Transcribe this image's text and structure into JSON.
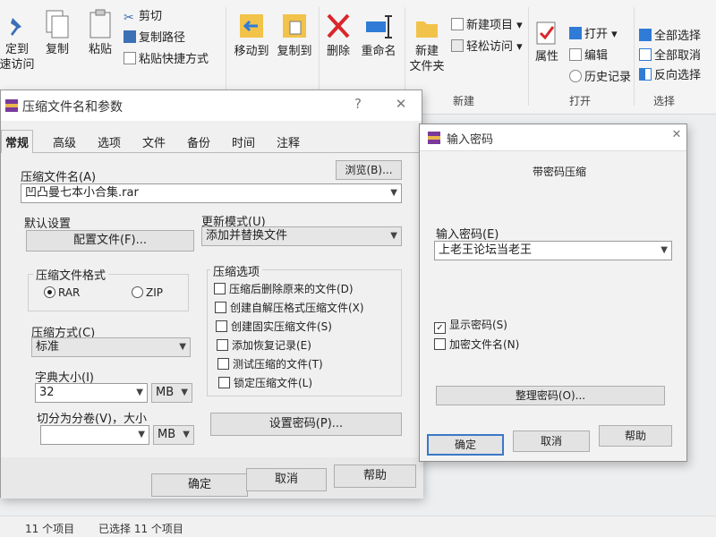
{
  "ribbon": {
    "pin_label": "定到\n速访问",
    "copy_label": "复制",
    "paste_label": "粘贴",
    "cut_label": "剪切",
    "copy_path_label": "复制路径",
    "paste_shortcut_label": "粘贴快捷方式",
    "move_to_label": "移动到",
    "copy_to_label": "复制到",
    "delete_label": "删除",
    "rename_label": "重命名",
    "new_folder_label": "新建\n文件夹",
    "new_item_label": "新建项目",
    "easy_access_label": "轻松访问",
    "new_group_label": "新建",
    "properties_label": "属性",
    "open_label": "打开",
    "edit_label": "编辑",
    "history_label": "历史记录",
    "open_group_label": "打开",
    "select_all_label": "全部选择",
    "select_none_label": "全部取消",
    "invert_selection_label": "反向选择",
    "select_group_label": "选择",
    "accent_delete": "#d9262b",
    "accent_blue": "#2f7bd6",
    "folder_yellow": "#f2c34a"
  },
  "compress_dialog": {
    "title": "压缩文件名和参数",
    "help_icon": "?",
    "close_icon": "✕",
    "tabs": [
      {
        "label": "常规"
      },
      {
        "label": "高级"
      },
      {
        "label": "选项"
      },
      {
        "label": "文件"
      },
      {
        "label": "备份"
      },
      {
        "label": "时间"
      },
      {
        "label": "注释"
      }
    ],
    "archive_name_label": "压缩文件名(A)",
    "browse_button": "浏览(B)...",
    "archive_name_value": "凹凸曼七本小合集.rar",
    "default_settings_label": "默认设置",
    "profiles_button": "配置文件(F)...",
    "update_mode_label": "更新模式(U)",
    "update_mode_value": "添加并替换文件",
    "format_group_label": "压缩文件格式",
    "format_rar": "RAR",
    "format_zip": "ZIP",
    "options_group_label": "压缩选项",
    "options": [
      {
        "label": "压缩后删除原来的文件(D)",
        "checked": false
      },
      {
        "label": "创建自解压格式压缩文件(X)",
        "checked": false
      },
      {
        "label": "创建固实压缩文件(S)",
        "checked": false
      },
      {
        "label": "添加恢复记录(E)",
        "checked": false
      },
      {
        "label": "测试压缩的文件(T)",
        "checked": false
      },
      {
        "label": "锁定压缩文件(L)",
        "checked": false
      }
    ],
    "method_label": "压缩方式(C)",
    "method_value": "标准",
    "dict_label": "字典大小(I)",
    "dict_value": "32",
    "dict_unit": "MB",
    "split_label": "切分为分卷(V)，大小",
    "split_unit": "MB",
    "set_password_button": "设置密码(P)...",
    "ok_button": "确定",
    "cancel_button": "取消",
    "help_button": "帮助"
  },
  "password_dialog": {
    "title": "输入密码",
    "close_icon": "✕",
    "subtitle": "带密码压缩",
    "password_label": "输入密码(E)",
    "password_value": "上老王论坛当老王",
    "show_password_label": "显示密码(S)",
    "show_password_checked": true,
    "encrypt_names_label": "加密文件名(N)",
    "encrypt_names_checked": false,
    "organize_button": "整理密码(O)...",
    "ok_button": "确定",
    "cancel_button": "取消",
    "help_button": "帮助"
  },
  "statusbar": {
    "item_count": "11 个项目",
    "selected_count": "已选择 11 个项目"
  }
}
